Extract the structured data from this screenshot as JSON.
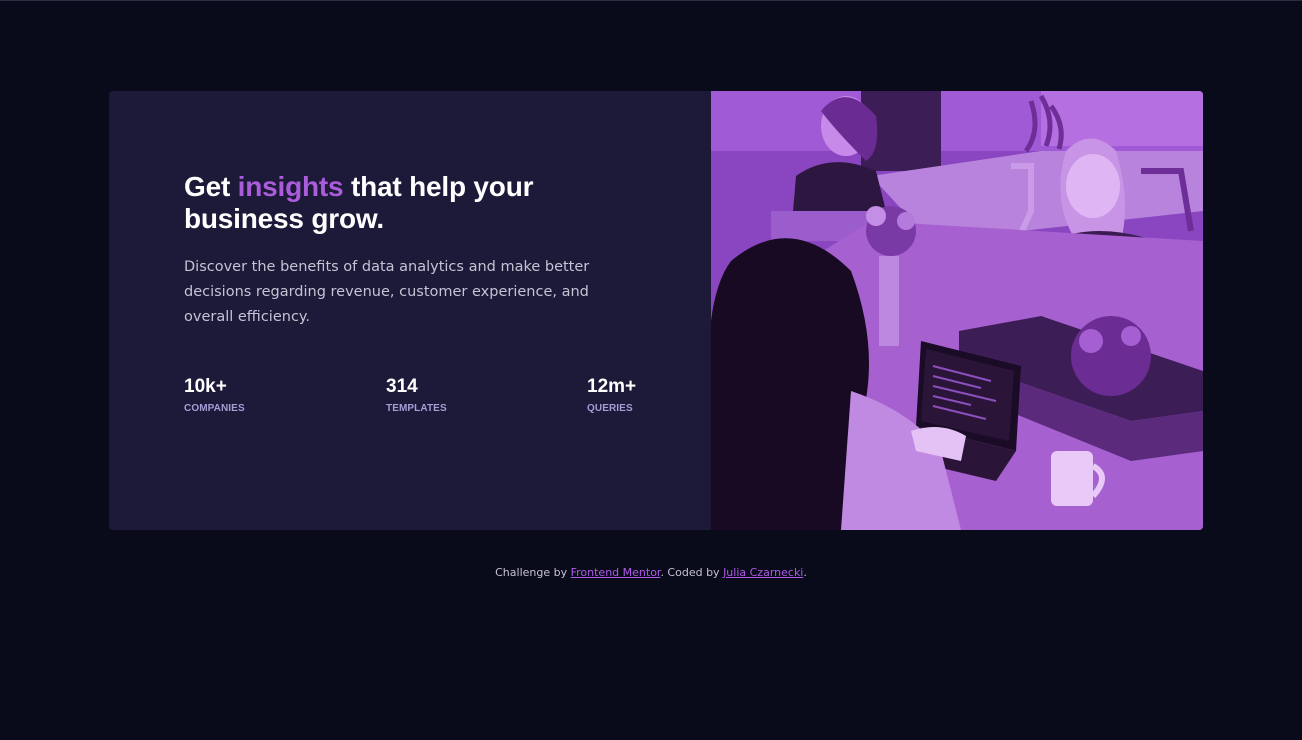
{
  "card": {
    "title_part1": "Get ",
    "title_accent": "insights",
    "title_part2": " that help your business grow.",
    "description": "Discover the benefits of data analytics and make better decisions regarding revenue, customer experience, and overall efficiency.",
    "stats": [
      {
        "value": "10k+",
        "label": "COMPANIES"
      },
      {
        "value": "314",
        "label": "TEMPLATES"
      },
      {
        "value": "12m+",
        "label": "QUERIES"
      }
    ],
    "image_icon": "office-team-photo"
  },
  "footer": {
    "prefix": "Challenge by ",
    "link1": "Frontend Mentor",
    "middle": ". Coded by ",
    "link2": "Julia Czarnecki",
    "suffix": "."
  },
  "colors": {
    "page_bg": "#090b1a",
    "card_bg": "#1c1a38",
    "accent": "#aa5cdb",
    "image_tint": "#7d3eb0",
    "stat_label": "#a39fd6"
  }
}
